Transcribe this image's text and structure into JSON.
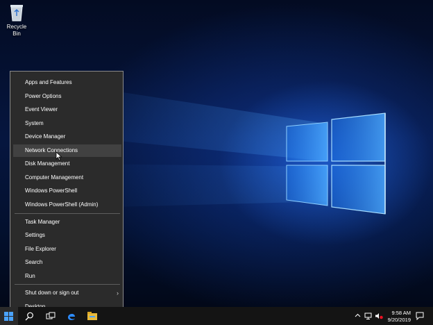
{
  "desktop": {
    "recycle_bin_label": "Recycle Bin"
  },
  "menu": {
    "group1": [
      {
        "label": "Apps and Features"
      },
      {
        "label": "Power Options"
      },
      {
        "label": "Event Viewer"
      },
      {
        "label": "System"
      },
      {
        "label": "Device Manager"
      },
      {
        "label": "Network Connections"
      },
      {
        "label": "Disk Management"
      },
      {
        "label": "Computer Management"
      },
      {
        "label": "Windows PowerShell"
      },
      {
        "label": "Windows PowerShell (Admin)"
      }
    ],
    "group2": [
      {
        "label": "Task Manager"
      },
      {
        "label": "Settings"
      },
      {
        "label": "File Explorer"
      },
      {
        "label": "Search"
      },
      {
        "label": "Run"
      }
    ],
    "group3": [
      {
        "label": "Shut down or sign out"
      },
      {
        "label": "Desktop"
      }
    ],
    "hovered_item": "Network Connections"
  },
  "taskbar": {
    "time": "9:58 AM",
    "date": "9/20/2019",
    "icons": [
      "windows-logo",
      "search",
      "task-view",
      "edge",
      "file-explorer"
    ],
    "tray_icons": [
      "chevron-up",
      "network",
      "volume-muted",
      "notifications"
    ]
  }
}
